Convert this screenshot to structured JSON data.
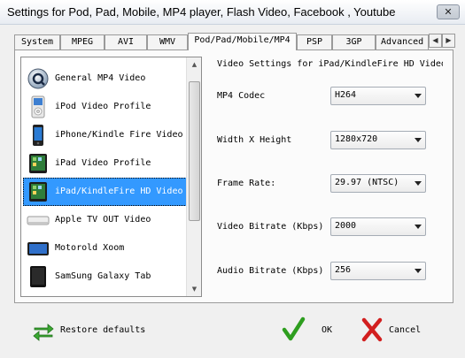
{
  "window": {
    "title": "Settings for Pod, Pad, Mobile, MP4 player, Flash Video, Facebook , Youtube",
    "close_glyph": "✕"
  },
  "tabs": [
    {
      "label": "System"
    },
    {
      "label": "MPEG"
    },
    {
      "label": "AVI"
    },
    {
      "label": "WMV"
    },
    {
      "label": "Pod/Pad/Mobile/MP4"
    },
    {
      "label": "PSP"
    },
    {
      "label": "3GP"
    },
    {
      "label": "Advanced"
    }
  ],
  "active_tab": "Pod/Pad/Mobile/MP4",
  "profiles": [
    {
      "label": "General MP4 Video",
      "icon": "quicktime-icon"
    },
    {
      "label": "iPod Video Profile",
      "icon": "ipod-icon"
    },
    {
      "label": "iPhone/Kindle Fire Video",
      "icon": "iphone-icon"
    },
    {
      "label": "iPad Video Profile",
      "icon": "ipad-icon"
    },
    {
      "label": "iPad/KindleFire HD Video",
      "icon": "ipad-icon"
    },
    {
      "label": "Apple TV OUT Video",
      "icon": "apple-tv-icon"
    },
    {
      "label": "Motorold Xoom",
      "icon": "tablet-icon"
    },
    {
      "label": "SamSung Galaxy Tab",
      "icon": "galaxy-tab-icon"
    }
  ],
  "selected_profile": "iPad/KindleFire HD Video",
  "settings": {
    "title": "Video Settings for iPad/KindleFire HD Video",
    "fields": [
      {
        "label": "MP4 Codec",
        "value": "H264"
      },
      {
        "label": "Width X Height",
        "value": "1280x720"
      },
      {
        "label": "Frame Rate:",
        "value": "29.97 (NTSC)"
      },
      {
        "label": "Video Bitrate (Kbps)",
        "value": "2000"
      },
      {
        "label": "Audio Bitrate (Kbps)",
        "value": "256"
      }
    ]
  },
  "footer": {
    "restore_label": "Restore defaults",
    "ok_label": "OK",
    "cancel_label": "Cancel"
  },
  "colors": {
    "selection": "#3399ff",
    "ok_check": "#2e9e1f",
    "cancel_x": "#d21f1f",
    "restore_arrows": "#3aa832"
  }
}
